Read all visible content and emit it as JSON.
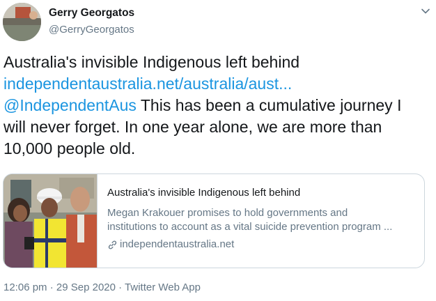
{
  "author": {
    "name": "Gerry Georgatos",
    "handle": "@GerryGeorgatos",
    "avatar_icon": "avatar-photo"
  },
  "menu_icon": "chevron-down-icon",
  "tweet": {
    "line1": "Australia's invisible Indigenous left behind",
    "link_url": "independentaustralia.net/australia/aust...",
    "mention": "@IndependentAus",
    "line3_rest": " This has been a cumulative journey I",
    "line4": "will never forget. In one year alone, we are more than",
    "line5": "10,000 people old."
  },
  "card": {
    "title": "Australia's invisible Indigenous left behind",
    "description_line1": "Megan Krakouer promises to hold governments and",
    "description_line2": "institutions to account as a vital suicide prevention program ...",
    "domain": "independentaustralia.net",
    "link_icon": "link-icon"
  },
  "meta": {
    "time": "12:06 pm",
    "separator1": " · ",
    "date": "29 Sep 2020",
    "separator2": " · ",
    "source": "Twitter Web App"
  },
  "colors": {
    "link": "#1b95e0",
    "secondary": "#657786",
    "text": "#14171a",
    "border": "#ccd6dd"
  }
}
